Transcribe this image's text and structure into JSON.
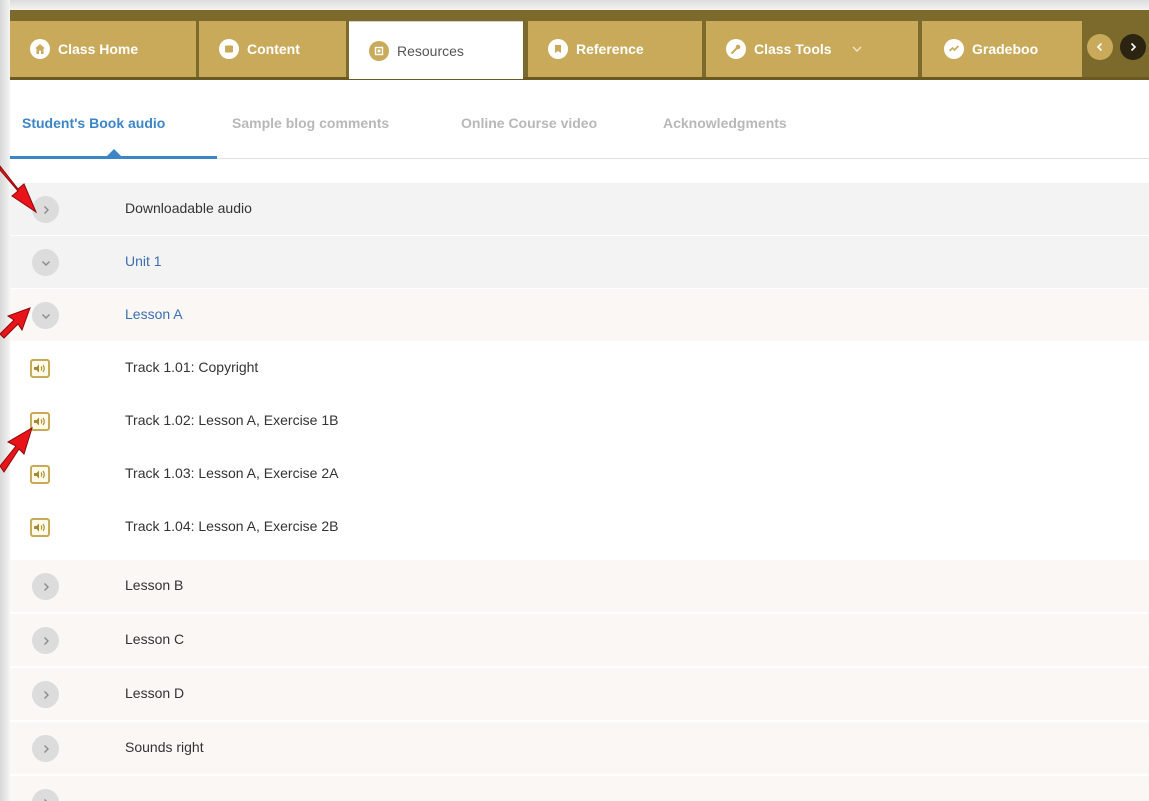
{
  "nav": {
    "tabs": [
      {
        "label": "Class Home",
        "icon": "home-icon"
      },
      {
        "label": "Content",
        "icon": "content-icon"
      },
      {
        "label": "Resources",
        "icon": "resources-icon",
        "active": true
      },
      {
        "label": "Reference",
        "icon": "reference-icon"
      },
      {
        "label": "Class Tools",
        "icon": "wrench-icon",
        "has_dropdown": true
      },
      {
        "label": "Gradeboo",
        "icon": "gradebook-icon"
      }
    ],
    "prev_icon": "chevron-left-icon",
    "next_icon": "chevron-right-icon"
  },
  "subtabs": [
    {
      "label": "Student's Book audio",
      "active": true
    },
    {
      "label": "Sample blog comments"
    },
    {
      "label": "Online Course video"
    },
    {
      "label": "Acknowledgments"
    }
  ],
  "rows": [
    {
      "label": "Downloadable audio",
      "icon": "chevron-right-icon",
      "type": "collapsed"
    },
    {
      "label": "Unit 1",
      "icon": "chevron-down-icon",
      "type": "expanded"
    },
    {
      "label": "Lesson A",
      "icon": "chevron-down-icon",
      "type": "expanded"
    },
    {
      "label": "Track 1.01: Copyright",
      "icon": "speaker-icon",
      "type": "audio"
    },
    {
      "label": "Track 1.02: Lesson A, Exercise 1B",
      "icon": "speaker-icon",
      "type": "audio"
    },
    {
      "label": "Track 1.03: Lesson A, Exercise 2A",
      "icon": "speaker-icon",
      "type": "audio"
    },
    {
      "label": "Track 1.04: Lesson A, Exercise 2B",
      "icon": "speaker-icon",
      "type": "audio"
    },
    {
      "label": "Lesson B",
      "icon": "chevron-right-icon",
      "type": "collapsed"
    },
    {
      "label": "Lesson C",
      "icon": "chevron-right-icon",
      "type": "collapsed"
    },
    {
      "label": "Lesson D",
      "icon": "chevron-right-icon",
      "type": "collapsed"
    },
    {
      "label": "Sounds right",
      "icon": "chevron-right-icon",
      "type": "collapsed"
    }
  ],
  "colors": {
    "nav_bg": "#7b6a2b",
    "tab_gold": "#c8aa5a",
    "link_blue": "#3b86c6",
    "annotation_red": "#e8141a"
  }
}
